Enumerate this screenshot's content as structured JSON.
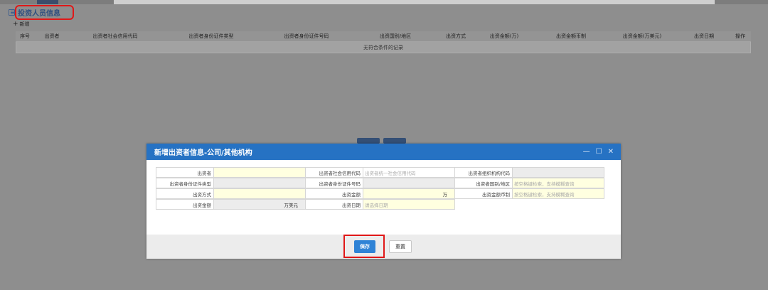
{
  "page": {
    "section_title": "投资人员信息",
    "add_label": "新增",
    "table": {
      "columns": [
        "序号",
        "出资者",
        "出资者社会信用代码",
        "出资者身份证件类型",
        "出资者身份证件号码",
        "出资国别/地区",
        "出资方式",
        "出资金额(万)",
        "出资金额币制",
        "出资金额(万美元)",
        "出资日期",
        "操作"
      ],
      "empty_text": "无符合条件的记录"
    }
  },
  "modal": {
    "title": "新增出资者信息-公司/其他机构",
    "controls": [
      "—",
      "☐",
      "✕"
    ],
    "rows": [
      [
        {
          "label": "出资者",
          "value": "",
          "placeholder": ""
        },
        {
          "label": "出资者社会信用代码",
          "value": "",
          "placeholder": "出资者统一社会信用代码"
        },
        {
          "label": "出资者组织机构代码",
          "value": "",
          "placeholder": ""
        }
      ],
      [
        {
          "label": "出资者身份证件类型",
          "value": "",
          "placeholder": ""
        },
        {
          "label": "出资者身份证件号码",
          "value": "",
          "placeholder": ""
        },
        {
          "label": "出资者国别/地区",
          "value": "",
          "placeholder": "按空格键检索，支持模糊查询"
        }
      ],
      [
        {
          "label": "出资方式",
          "value": "",
          "placeholder": ""
        },
        {
          "label": "出资金额",
          "value": "",
          "placeholder": "",
          "unit": "万"
        },
        {
          "label": "出资金额币制",
          "value": "",
          "placeholder": "按空格键检索，支持模糊查询"
        }
      ],
      [
        {
          "label": "出资金额",
          "value": "",
          "placeholder": "",
          "unit": "万美元"
        },
        {
          "label": "出资日期",
          "value": "",
          "placeholder": "请选择日期"
        }
      ]
    ],
    "save_label": "保存",
    "reset_label": "重置"
  },
  "colors": {
    "modal_header": "#2672c3",
    "save_button": "#2f83d6",
    "highlight": "#e01818",
    "required_field": "#ffffe0",
    "readonly_field": "#ececec"
  }
}
